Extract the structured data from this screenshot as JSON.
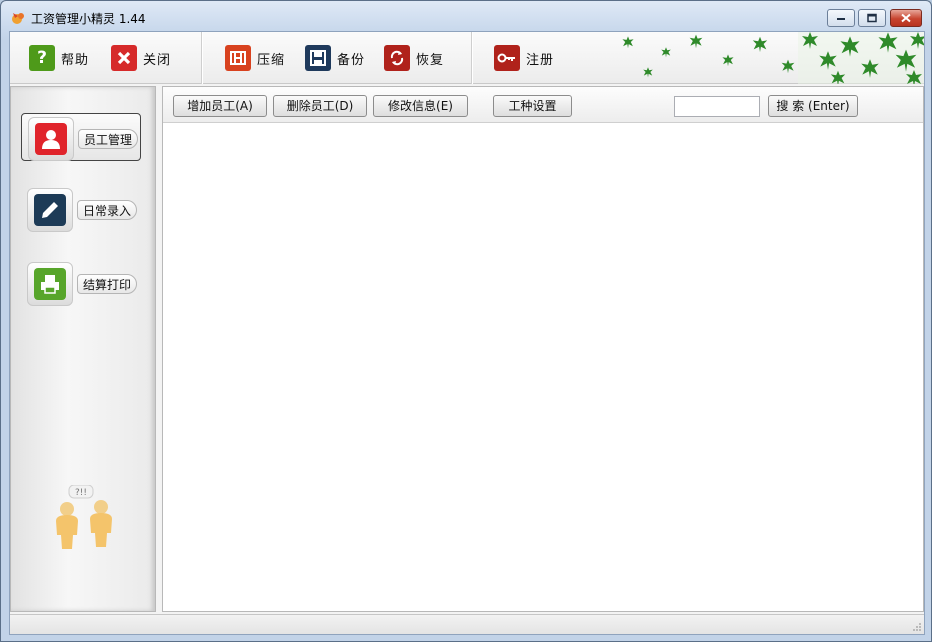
{
  "window": {
    "title": "工资管理小精灵 1.44",
    "controls": {
      "minimize": "minimize-icon",
      "maximize": "maximize-icon",
      "close": "close-icon"
    }
  },
  "toolbar": {
    "buttons": [
      {
        "label": "帮助",
        "icon": "help-icon",
        "color": "#4e9a1a"
      },
      {
        "label": "关闭",
        "icon": "close-icon",
        "color": "#d62a2a"
      },
      {
        "label": "压缩",
        "icon": "compress-icon",
        "color": "#d8421f"
      },
      {
        "label": "备份",
        "icon": "backup-icon",
        "color": "#1f3a5c"
      },
      {
        "label": "恢复",
        "icon": "restore-icon",
        "color": "#b0221b"
      },
      {
        "label": "注册",
        "icon": "register-key-icon",
        "color": "#b0221b"
      }
    ]
  },
  "sidebar": {
    "items": [
      {
        "label": "员工管理",
        "icon": "employee-icon",
        "color": "#e0242b",
        "active": true
      },
      {
        "label": "日常录入",
        "icon": "pen-icon",
        "color": "#1d3b57",
        "active": false
      },
      {
        "label": "结算打印",
        "icon": "printer-icon",
        "color": "#57a52a",
        "active": false
      }
    ],
    "illustration_text": "?!!"
  },
  "main": {
    "buttons": {
      "add_employee": "增加员工(A)",
      "delete_employee": "删除员工(D)",
      "edit_info": "修改信息(E)",
      "job_settings": "工种设置",
      "search": "搜 索 (Enter)"
    },
    "search": {
      "value": "",
      "placeholder": ""
    }
  },
  "statusbar": {
    "text": ""
  }
}
